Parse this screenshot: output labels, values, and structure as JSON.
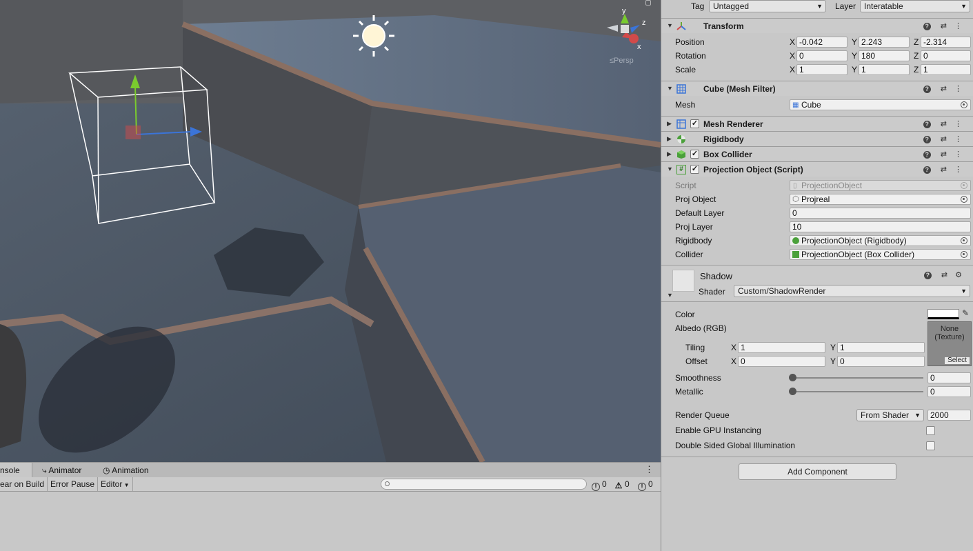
{
  "scene": {
    "persp_label": "≤Persp",
    "gizmo_y": "y",
    "gizmo_z": "z",
    "gizmo_x": "x"
  },
  "console": {
    "tabs": [
      "nsole",
      "Animator",
      "Animation"
    ],
    "tools": {
      "clear_on_build": "ear on Build",
      "error_pause": "Error Pause",
      "editor": "Editor"
    },
    "search_placeholder": "",
    "counts": {
      "errors": "0",
      "warnings": "0",
      "logs": "0"
    }
  },
  "inspector": {
    "tag_label": "Tag",
    "tag_value": "Untagged",
    "layer_label": "Layer",
    "layer_value": "Interatable",
    "transform": {
      "title": "Transform",
      "position_label": "Position",
      "rotation_label": "Rotation",
      "scale_label": "Scale",
      "position": {
        "x": "-0.042",
        "y": "2.243",
        "z": "-2.314"
      },
      "rotation": {
        "x": "0",
        "y": "180",
        "z": "0"
      },
      "scale": {
        "x": "1",
        "y": "1",
        "z": "1"
      },
      "axis_x": "X",
      "axis_y": "Y",
      "axis_z": "Z"
    },
    "mesh_filter": {
      "title": "Cube (Mesh Filter)",
      "mesh_label": "Mesh",
      "mesh_value": "Cube"
    },
    "mesh_renderer": {
      "title": "Mesh Renderer"
    },
    "rigidbody": {
      "title": "Rigidbody"
    },
    "box_collider": {
      "title": "Box Collider"
    },
    "projection": {
      "title": "Projection Object (Script)",
      "script_label": "Script",
      "script_value": "ProjectionObject",
      "proj_object_label": "Proj Object",
      "proj_object_value": "Projreal",
      "default_layer_label": "Default Layer",
      "default_layer_value": "0",
      "proj_layer_label": "Proj Layer",
      "proj_layer_value": "10",
      "rigidbody_label": "Rigidbody",
      "rigidbody_value": "ProjectionObject (Rigidbody)",
      "collider_label": "Collider",
      "collider_value": "ProjectionObject (Box Collider)"
    },
    "material": {
      "name": "Shadow",
      "shader_label": "Shader",
      "shader_value": "Custom/ShadowRender",
      "color_label": "Color",
      "albedo_label": "Albedo (RGB)",
      "texture_none": "None",
      "texture_type": "(Texture)",
      "texture_select": "Select",
      "tiling_label": "Tiling",
      "offset_label": "Offset",
      "tiling": {
        "x": "1",
        "y": "1"
      },
      "offset": {
        "x": "0",
        "y": "0"
      },
      "smoothness_label": "Smoothness",
      "smoothness_value": "0",
      "metallic_label": "Metallic",
      "metallic_value": "0",
      "render_queue_label": "Render Queue",
      "render_queue_mode": "From Shader",
      "render_queue_value": "2000",
      "gpu_instancing_label": "Enable GPU Instancing",
      "double_sided_gi_label": "Double Sided Global Illumination"
    },
    "add_component": "Add Component"
  }
}
